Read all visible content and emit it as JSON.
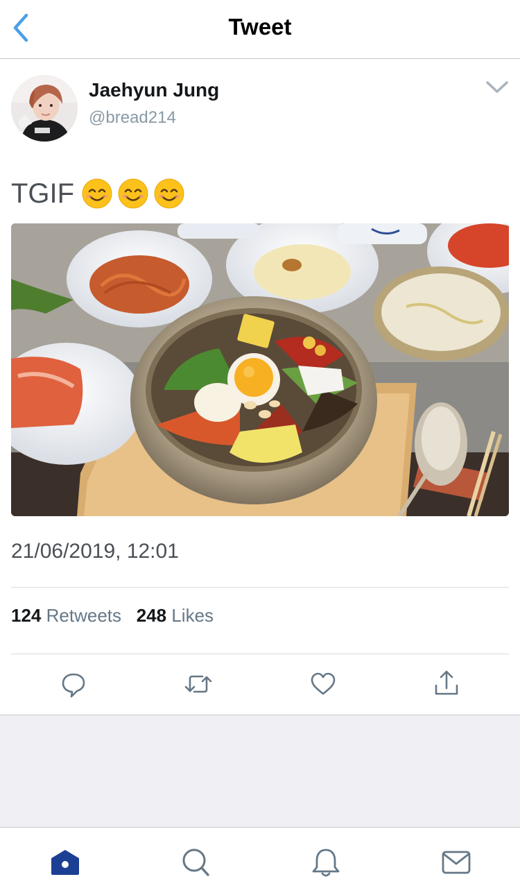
{
  "header": {
    "title": "Tweet"
  },
  "author": {
    "name": "Jaehyun Jung",
    "handle": "@bread214"
  },
  "tweet": {
    "text": "TGIF",
    "emojis": [
      "smiling-face-icon",
      "smiling-face-icon",
      "smiling-face-icon"
    ],
    "timestamp": "21/06/2019, 12:01"
  },
  "stats": {
    "retweets_count": "124",
    "retweets_label": "Retweets",
    "likes_count": "248",
    "likes_label": "Likes"
  },
  "actions": [
    "reply-icon",
    "retweet-icon",
    "like-icon",
    "share-icon"
  ],
  "tabs": [
    "home-icon",
    "search-icon",
    "notifications-icon",
    "messages-icon"
  ],
  "colors": {
    "accent": "#1da1f2",
    "tab_active": "#1c3f94",
    "icon_gray": "#657786",
    "separator_bg": "#efeff4"
  }
}
